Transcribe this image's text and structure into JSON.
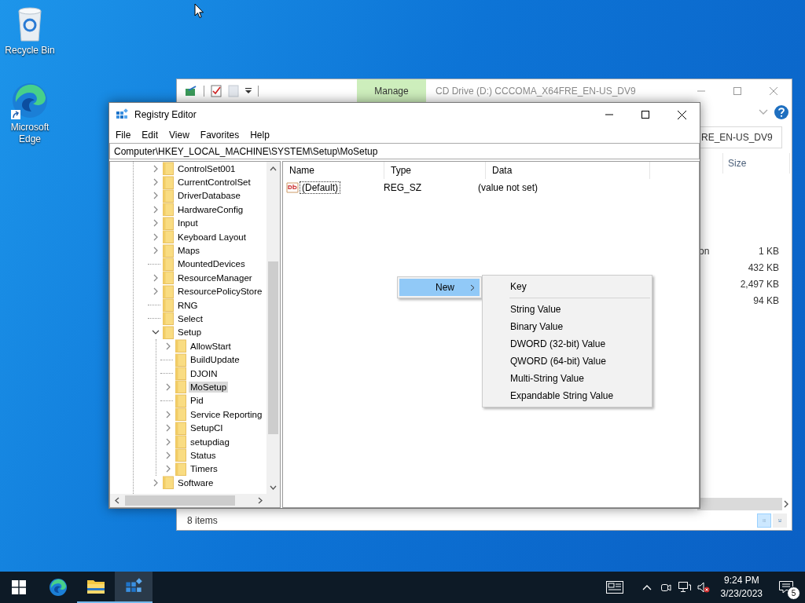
{
  "desktop_icons": [
    {
      "label": "Recycle Bin",
      "kind": "recycle-bin"
    },
    {
      "label": "Microsoft Edge",
      "kind": "edge"
    }
  ],
  "explorer": {
    "ribbon_tab": "Manage",
    "title": "CD Drive (D:) CCCOMA_X64FRE_EN-US_DV9",
    "address": "RE_EN-US_DV9",
    "columns": [
      "Size"
    ],
    "rows": [
      {
        "column_2": "on",
        "size": "1 KB"
      },
      {
        "size": "432 KB"
      },
      {
        "size": "2,497 KB"
      },
      {
        "size": "94 KB"
      }
    ],
    "status_bar": "8 items"
  },
  "registry_editor": {
    "title": "Registry Editor",
    "menu": [
      "File",
      "Edit",
      "View",
      "Favorites",
      "Help"
    ],
    "address": "Computer\\HKEY_LOCAL_MACHINE\\SYSTEM\\Setup\\MoSetup",
    "tree": [
      {
        "label": "ControlSet001",
        "expandable": true,
        "expanded": false,
        "selected": false
      },
      {
        "label": "CurrentControlSet",
        "expandable": true,
        "expanded": false,
        "selected": false
      },
      {
        "label": "DriverDatabase",
        "expandable": true,
        "expanded": false,
        "selected": false
      },
      {
        "label": "HardwareConfig",
        "expandable": true,
        "expanded": false,
        "selected": false
      },
      {
        "label": "Input",
        "expandable": true,
        "expanded": false,
        "selected": false
      },
      {
        "label": "Keyboard Layout",
        "expandable": true,
        "expanded": false,
        "selected": false
      },
      {
        "label": "Maps",
        "expandable": true,
        "expanded": false,
        "selected": false
      },
      {
        "label": "MountedDevices",
        "expandable": false,
        "expanded": false,
        "selected": false
      },
      {
        "label": "ResourceManager",
        "expandable": true,
        "expanded": false,
        "selected": false
      },
      {
        "label": "ResourcePolicyStore",
        "expandable": true,
        "expanded": false,
        "selected": false
      },
      {
        "label": "RNG",
        "expandable": false,
        "expanded": false,
        "selected": false
      },
      {
        "label": "Select",
        "expandable": false,
        "expanded": false,
        "selected": false
      },
      {
        "label": "Setup",
        "expandable": true,
        "expanded": true,
        "selected": false,
        "children": [
          {
            "label": "AllowStart",
            "expandable": true,
            "expanded": false,
            "selected": false
          },
          {
            "label": "BuildUpdate",
            "expandable": false,
            "expanded": false,
            "selected": false
          },
          {
            "label": "DJOIN",
            "expandable": false,
            "expanded": false,
            "selected": false
          },
          {
            "label": "MoSetup",
            "expandable": true,
            "expanded": false,
            "selected": true
          },
          {
            "label": "Pid",
            "expandable": false,
            "expanded": false,
            "selected": false
          },
          {
            "label": "Service Reporting",
            "expandable": true,
            "expanded": false,
            "selected": false
          },
          {
            "label": "SetupCI",
            "expandable": true,
            "expanded": false,
            "selected": false
          },
          {
            "label": "setupdiag",
            "expandable": true,
            "expanded": false,
            "selected": false
          },
          {
            "label": "Status",
            "expandable": true,
            "expanded": false,
            "selected": false
          },
          {
            "label": "Timers",
            "expandable": true,
            "expanded": false,
            "selected": false
          }
        ]
      },
      {
        "label": "Software",
        "expandable": true,
        "expanded": false,
        "selected": false
      }
    ],
    "columns": [
      "Name",
      "Type",
      "Data"
    ],
    "rows": [
      {
        "name": "(Default)",
        "type": "REG_SZ",
        "data": "(value not set)",
        "focused": true
      }
    ]
  },
  "context_menu": {
    "items": [
      {
        "label": "New",
        "selected": true
      }
    ],
    "submenu": [
      {
        "kind": "item",
        "label": "Key"
      },
      {
        "kind": "separator"
      },
      {
        "kind": "item",
        "label": "String Value"
      },
      {
        "kind": "item",
        "label": "Binary Value"
      },
      {
        "kind": "item",
        "label": "DWORD (32-bit) Value"
      },
      {
        "kind": "item",
        "label": "QWORD (64-bit) Value"
      },
      {
        "kind": "item",
        "label": "Multi-String Value"
      },
      {
        "kind": "item",
        "label": "Expandable String Value"
      }
    ]
  },
  "taskbar": {
    "apps": [
      {
        "kind": "edge",
        "running": false,
        "selected": false
      },
      {
        "kind": "explorer",
        "running": true,
        "selected": false
      },
      {
        "kind": "regedit",
        "running": true,
        "selected": true
      }
    ],
    "time": "9:24 PM",
    "date": "3/23/2023",
    "notification_count": "5"
  }
}
